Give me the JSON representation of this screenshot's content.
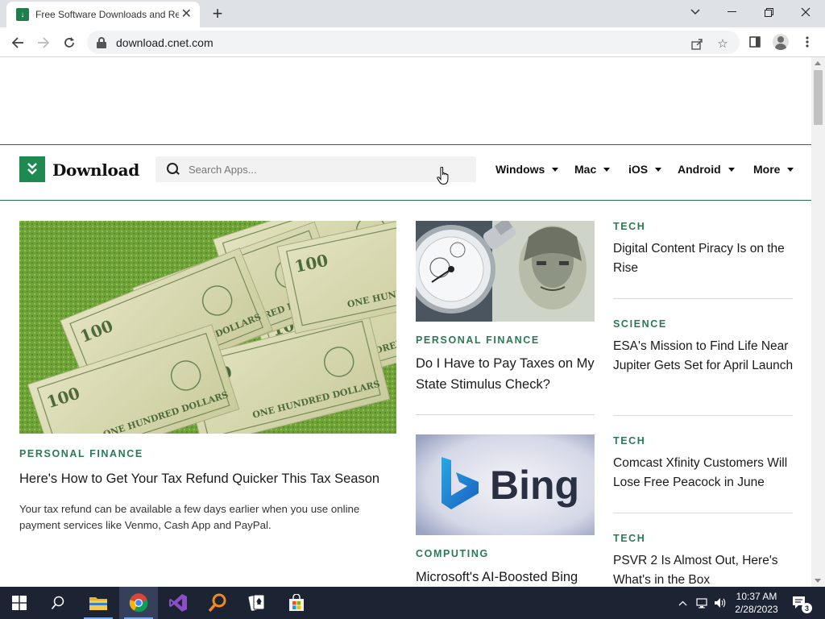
{
  "browser": {
    "tab_title": "Free Software Downloads and Reviews",
    "url": "download.cnet.com"
  },
  "site": {
    "logo_text": "Download",
    "search_placeholder": "Search Apps...",
    "nav": [
      "Windows",
      "Mac",
      "iOS",
      "Android",
      "More"
    ]
  },
  "featured": {
    "category": "PERSONAL FINANCE",
    "title": "Here's How to Get Your Tax Refund Quicker This Tax Season",
    "summary": "Your tax refund can be available a few days earlier when you use online payment services like Venmo, Cash App and PayPal."
  },
  "middle_articles": [
    {
      "category": "PERSONAL FINANCE",
      "title": "Do I Have to Pay Taxes on My State Stimulus Check?"
    },
    {
      "category": "COMPUTING",
      "title": "Microsoft's AI-Boosted Bing",
      "image_text": "Bing"
    }
  ],
  "right_articles": [
    {
      "category": "TECH",
      "title": "Digital Content Piracy Is on the Rise"
    },
    {
      "category": "SCIENCE",
      "title": "ESA's Mission to Find Life Near Jupiter Gets Set for April Launch"
    },
    {
      "category": "TECH",
      "title": "Comcast Xfinity Customers Will Lose Free Peacock in June"
    },
    {
      "category": "TECH",
      "title": "PSVR 2 Is Almost Out, Here's What's in the Box"
    }
  ],
  "money_bill_text": "ONE HUNDRED DOLLARS",
  "money_bill_number": "100",
  "taskbar": {
    "time": "10:37 AM",
    "date": "2/28/2023",
    "notification_count": "3"
  },
  "colors": {
    "brand_green": "#1e8a50",
    "category_green": "#2b7a55",
    "taskbar_bg": "#1c2333"
  }
}
